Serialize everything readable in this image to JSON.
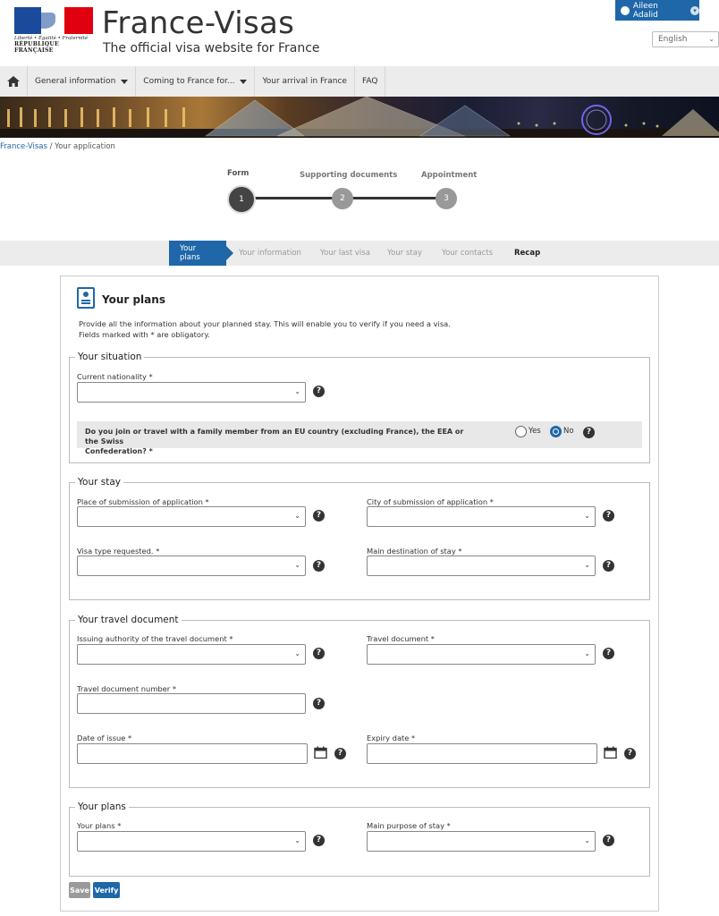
{
  "header": {
    "motto": "Liberté • Égalité • Fraternité",
    "republic": "RÉPUBLIQUE FRANÇAISE",
    "title": "France-Visas",
    "subtitle": "The official visa website for France",
    "user_name": "Aileen Adalid",
    "language": "English"
  },
  "nav": {
    "home_icon": "home-icon",
    "items": [
      {
        "label": "General information",
        "dropdown": true
      },
      {
        "label": "Coming to France for...",
        "dropdown": true
      },
      {
        "label": "Your arrival in France",
        "dropdown": false
      },
      {
        "label": "FAQ",
        "dropdown": false
      }
    ]
  },
  "breadcrumb": {
    "root": "France-Visas",
    "separator": " / ",
    "current": "Your application"
  },
  "stepper": {
    "steps": [
      {
        "label": "Form",
        "number": "1",
        "active": true
      },
      {
        "label": "Supporting documents",
        "number": "2",
        "active": false
      },
      {
        "label": "Appointment",
        "number": "3",
        "active": false
      }
    ]
  },
  "subtabs": [
    {
      "label": "Your plans",
      "state": "active"
    },
    {
      "label": "Your information",
      "state": "disabled"
    },
    {
      "label": "Your last visa",
      "state": "disabled"
    },
    {
      "label": "Your stay",
      "state": "disabled"
    },
    {
      "label": "Your contacts",
      "state": "disabled"
    },
    {
      "label": "Recap",
      "state": "enabled"
    }
  ],
  "panel": {
    "title": "Your plans",
    "intro_line1": "Provide all the information about your planned stay. This will enable you to verify if you need a visa.",
    "intro_line2": "Fields marked with * are obligatory."
  },
  "situation": {
    "legend": "Your situation",
    "nationality_label": "Current nationality *",
    "nationality_value": "",
    "family_question_line1": "Do you join or travel with a family member from an EU country (excluding France), the EEA or the Swiss",
    "family_question_line2": "Confederation? *",
    "yes_label": "Yes",
    "no_label": "No",
    "selected": "No"
  },
  "stay": {
    "legend": "Your stay",
    "place_label": "Place of submission of application *",
    "city_label": "City of submission of application *",
    "visa_type_label": "Visa type requested. *",
    "destination_label": "Main destination of stay *"
  },
  "travel_document": {
    "legend": "Your travel document",
    "authority_label": "Issuing authority of the travel document *",
    "document_label": "Travel document *",
    "number_label": "Travel document number *",
    "issue_date_label": "Date of issue *",
    "expiry_date_label": "Expiry date *"
  },
  "plans": {
    "legend": "Your plans",
    "plans_label": "Your plans *",
    "purpose_label": "Main purpose of stay *"
  },
  "actions": {
    "save_label": "Save",
    "verify_label": "Verify"
  },
  "colors": {
    "accent": "#1f67a8",
    "flag_blue": "#1a4a9c",
    "flag_red": "#e1000f",
    "step_active": "#444444",
    "step_inactive": "#999999"
  },
  "help_glyph": "?",
  "select_arrow": "⌄"
}
